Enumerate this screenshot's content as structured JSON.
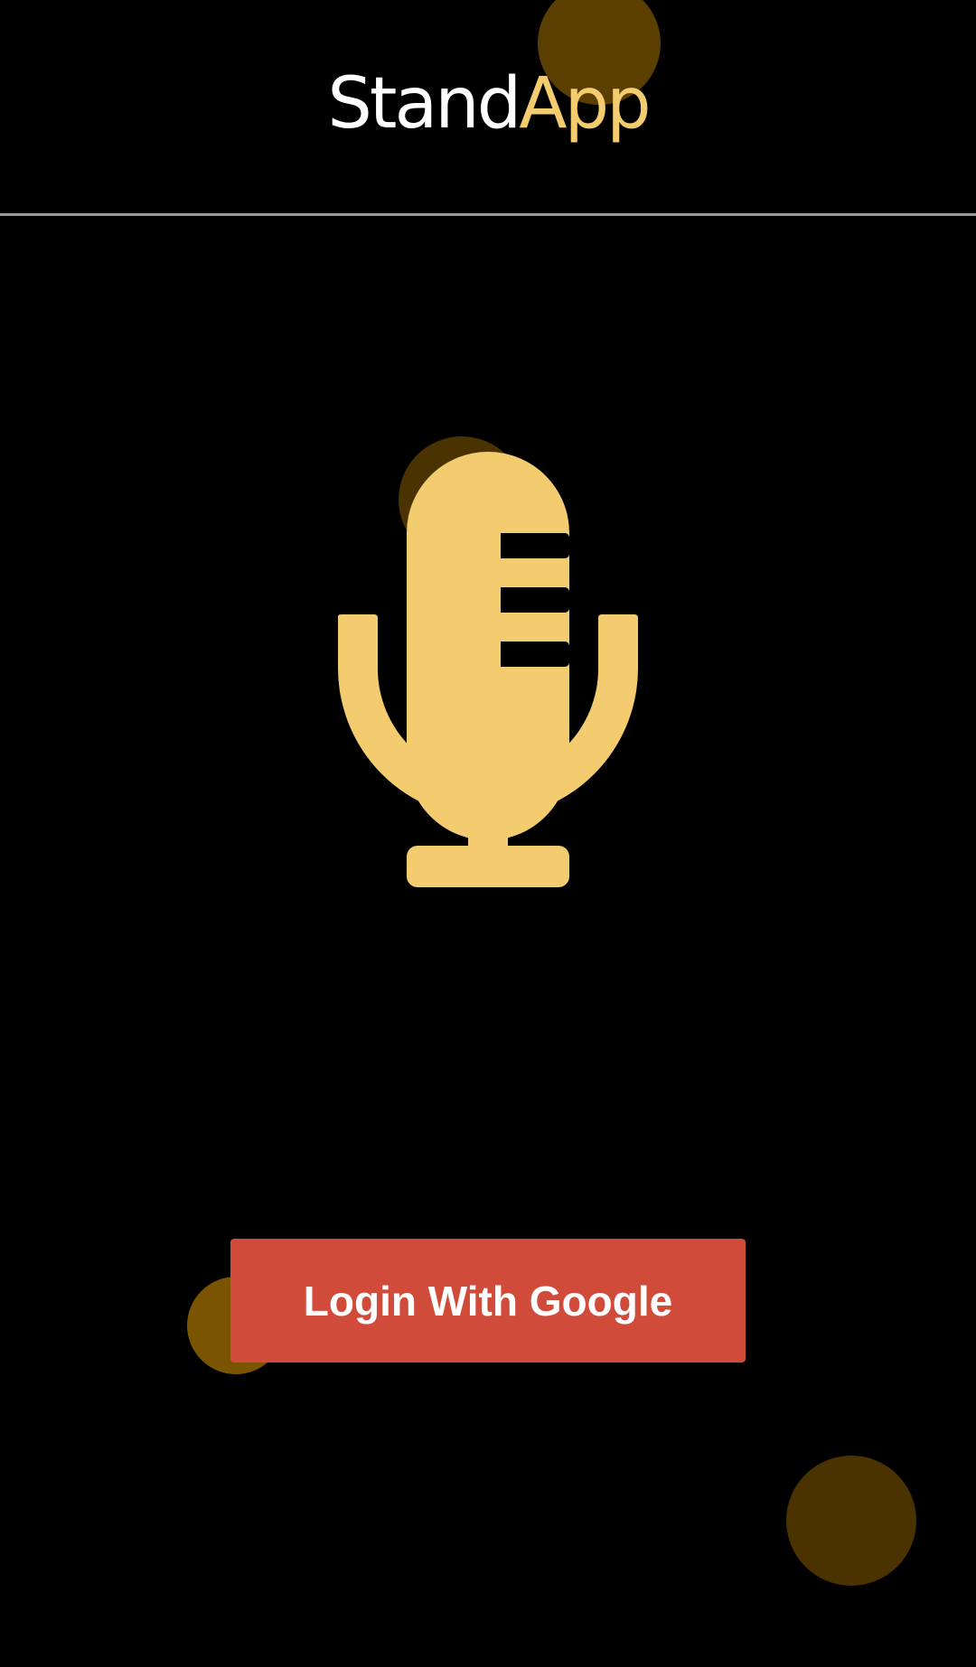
{
  "app": {
    "logo_part_1": "Stand",
    "logo_part_2": "App"
  },
  "auth": {
    "login_button_label": "Login With Google"
  },
  "icons": {
    "main": "microphone-icon"
  },
  "colors": {
    "background": "#000000",
    "accent": "#f2cc6e",
    "button": "#d14b3b",
    "divider": "#9a9a9a",
    "bubble_dark": "#5a3f00",
    "bubble_mid": "#7a5400",
    "bubble_deep": "#4a3300"
  }
}
